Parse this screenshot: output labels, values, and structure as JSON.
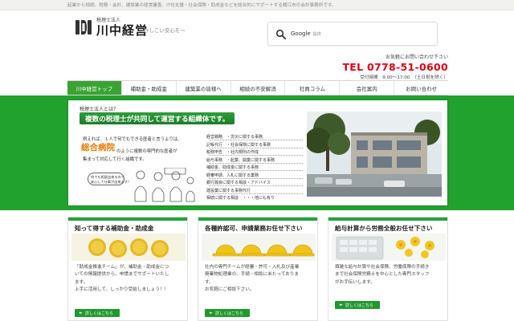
{
  "topbar": {
    "text": "起業から相続、税務・会計、建設業の経営審査、IT化支援・社会保険・助成金などを総合的にサポートする鯖江市の会計事務所です。"
  },
  "logo": {
    "subtitle": "税理士法人",
    "name": "川中経営",
    "tagline": "～かしこい安心を～"
  },
  "search": {
    "label": "Google",
    "suffix": "提供"
  },
  "contact": {
    "note": "お気軽にお問い合わせ下さい",
    "tel": "TEL 0778-51-0600",
    "hours": "受付時間　9:00～17:00　（土日祝を除く）"
  },
  "nav": {
    "items": [
      {
        "label": "川中経営トップ",
        "active": true
      },
      {
        "label": "補助金・助成金",
        "active": false
      },
      {
        "label": "建築業の皆様へ",
        "active": false
      },
      {
        "label": "相続の不安解消",
        "active": false
      },
      {
        "label": "社員コラム",
        "active": false
      },
      {
        "label": "会社案内",
        "active": false
      },
      {
        "label": "お問い合わせ",
        "active": false
      }
    ]
  },
  "hero": {
    "question": "税理士法人とは？",
    "title": "複数の税理士が共同して運営する組織体です。",
    "example_1": "例えれば、１人で何でもできる医者と言うよりは、",
    "highlight": "総合病院",
    "example_2": "のように複数の専門的な医者が",
    "example_3": "集まって対応して行く組織です。",
    "bubble_1": "何でも相談出来るので",
    "bubble_2": "安心して仕事が出来ます！",
    "services": [
      "経営戦略　・労災に関する事務",
      "記帳代行　・社会保険に関する事務",
      "税務申告　・社内規則の作成",
      "給与事務　・起業、開業に関する事務",
      "補助金、助成金に関する事務",
      "経審申請、入札に関する業務",
      "銀行融資に関する相談・アドバイス",
      "建設業に関する事務代行",
      "相続に関する相談　・・・他にも有り"
    ]
  },
  "cards": [
    {
      "title": "知って得する補助金・助成金",
      "lines": [
        "「助成金推進チーム」が、補助金・助成金につ",
        "いての情報提供から、申請までサポートいたし",
        "ます。",
        "上手に活用して、しっかり受給しましょう！！"
      ],
      "button": "詳しくはこちら"
    },
    {
      "title": "各種許認可、申請業務お任せ下さい",
      "lines": [
        "社内の専門チームが経審・許可・入札及び産業",
        "廃棄物処理業の、手続・相談にあたっておりま",
        "す。",
        "お気軽にご相談下さい。"
      ],
      "button": "詳しくはこちら"
    },
    {
      "title": "給与計算から労務全般お任せ下さい",
      "lines": [
        "煩雑な給与計算や社会保険、労働保険の手続き",
        "まで社会保険労務士を中心とした専門スタッフ",
        "がお手伝いします。"
      ],
      "button": "詳しくはこちら"
    }
  ],
  "colors": {
    "brand_green": "#21a12e",
    "nav_active": "#3aa332",
    "tel_red": "#e50012",
    "highlight_orange": "#e37a00"
  }
}
